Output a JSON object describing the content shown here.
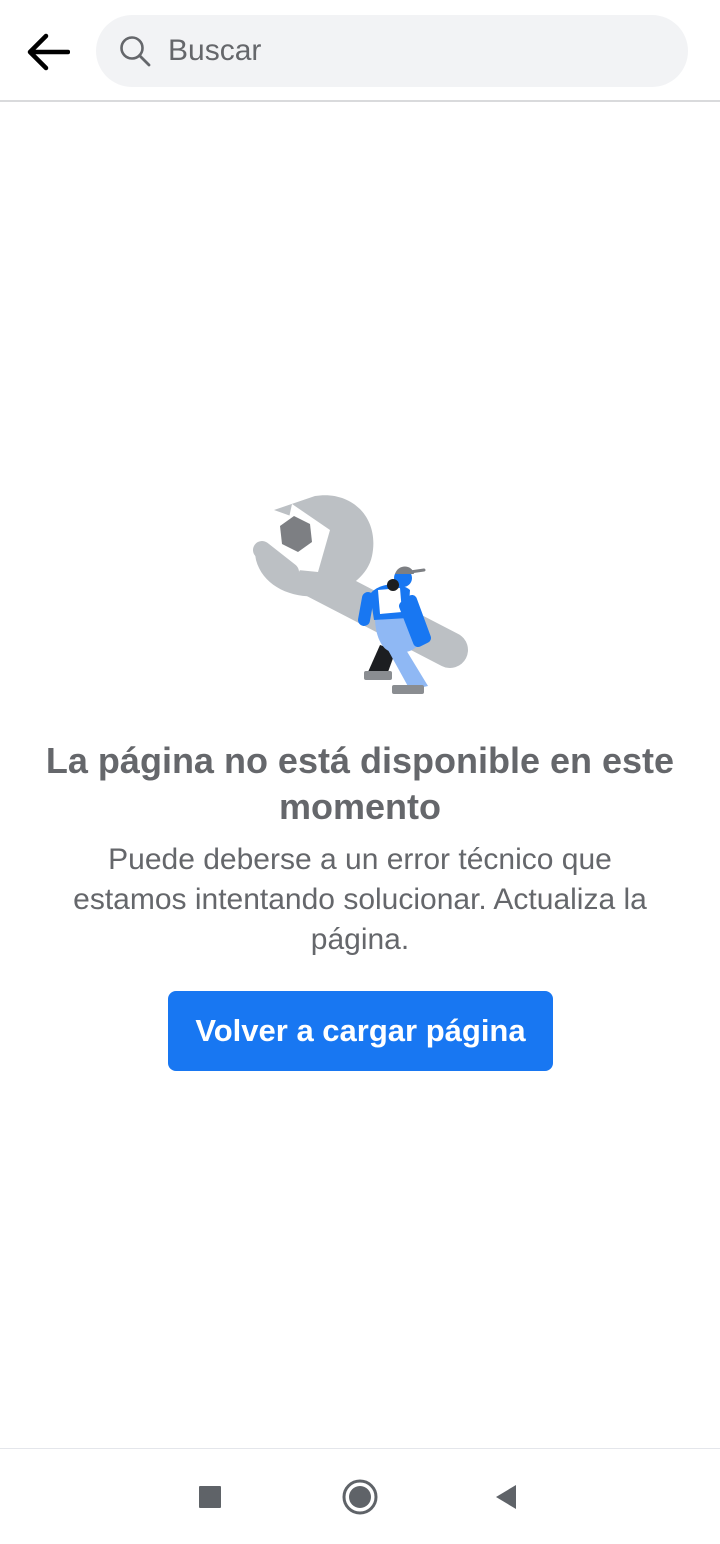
{
  "header": {
    "back_icon": "arrow-left-icon",
    "search": {
      "icon": "search-icon",
      "placeholder": "Buscar",
      "value": ""
    }
  },
  "error": {
    "illustration": "wrench-repair-person-illustration",
    "title": "La página no está disponible en este momento",
    "message": "Puede deberse a un error técnico que estamos intentando solucionar. Actualiza la página.",
    "reload_label": "Volver a cargar página"
  },
  "nav": {
    "recent_icon": "square-icon",
    "home_icon": "circle-home-icon",
    "back_icon": "triangle-back-icon"
  },
  "colors": {
    "accent": "#1877f2",
    "text_secondary": "#65676b",
    "search_bg": "#f2f3f5",
    "divider": "#d9dadc"
  }
}
